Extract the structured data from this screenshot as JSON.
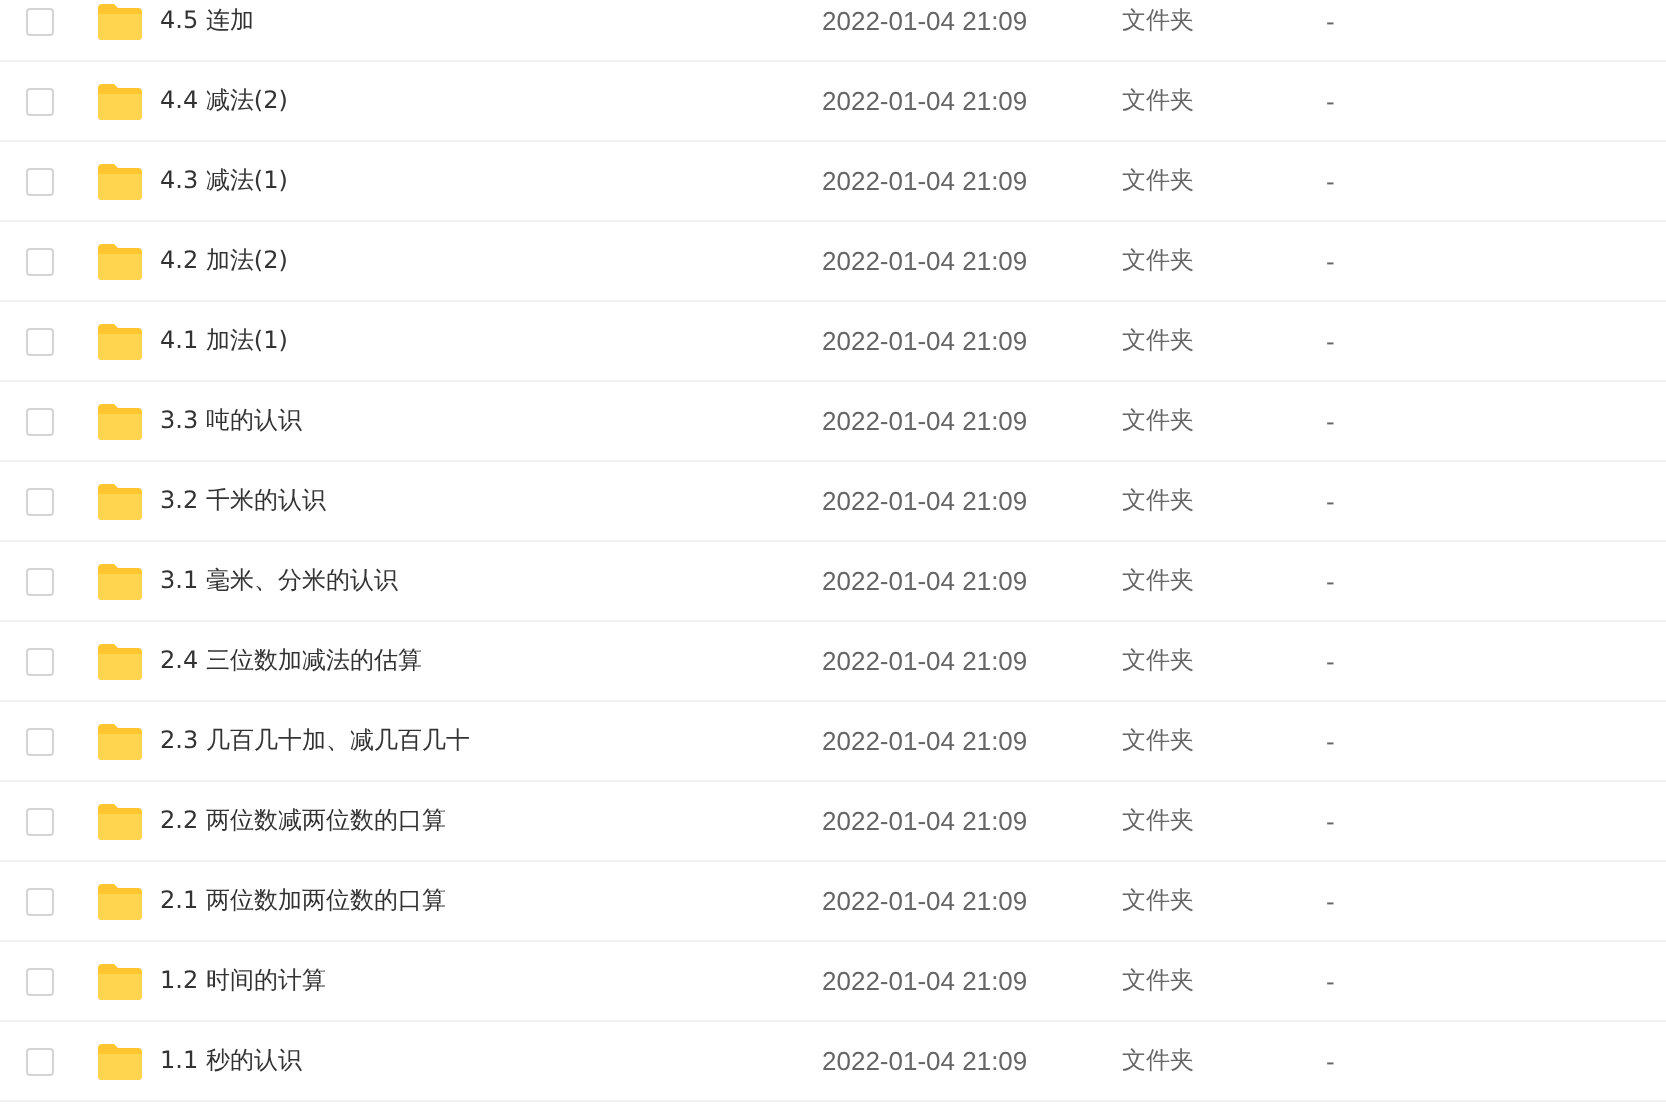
{
  "files": [
    {
      "name": "4.5 连加",
      "modified": "2022-01-04 21:09",
      "type": "文件夹",
      "size": "-",
      "checked": false
    },
    {
      "name": "4.4 减法(2)",
      "modified": "2022-01-04 21:09",
      "type": "文件夹",
      "size": "-",
      "checked": false
    },
    {
      "name": "4.3 减法(1)",
      "modified": "2022-01-04 21:09",
      "type": "文件夹",
      "size": "-",
      "checked": false
    },
    {
      "name": "4.2 加法(2)",
      "modified": "2022-01-04 21:09",
      "type": "文件夹",
      "size": "-",
      "checked": false
    },
    {
      "name": "4.1 加法(1)",
      "modified": "2022-01-04 21:09",
      "type": "文件夹",
      "size": "-",
      "checked": false
    },
    {
      "name": "3.3 吨的认识",
      "modified": "2022-01-04 21:09",
      "type": "文件夹",
      "size": "-",
      "checked": false
    },
    {
      "name": "3.2 千米的认识",
      "modified": "2022-01-04 21:09",
      "type": "文件夹",
      "size": "-",
      "checked": false
    },
    {
      "name": "3.1 毫米、分米的认识",
      "modified": "2022-01-04 21:09",
      "type": "文件夹",
      "size": "-",
      "checked": false
    },
    {
      "name": "2.4 三位数加减法的估算",
      "modified": "2022-01-04 21:09",
      "type": "文件夹",
      "size": "-",
      "checked": false
    },
    {
      "name": "2.3 几百几十加、减几百几十",
      "modified": "2022-01-04 21:09",
      "type": "文件夹",
      "size": "-",
      "checked": false
    },
    {
      "name": "2.2 两位数减两位数的口算",
      "modified": "2022-01-04 21:09",
      "type": "文件夹",
      "size": "-",
      "checked": false
    },
    {
      "name": "2.1 两位数加两位数的口算",
      "modified": "2022-01-04 21:09",
      "type": "文件夹",
      "size": "-",
      "checked": false
    },
    {
      "name": "1.2 时间的计算",
      "modified": "2022-01-04 21:09",
      "type": "文件夹",
      "size": "-",
      "checked": false
    },
    {
      "name": "1.1 秒的认识",
      "modified": "2022-01-04 21:09",
      "type": "文件夹",
      "size": "-",
      "checked": false
    }
  ]
}
